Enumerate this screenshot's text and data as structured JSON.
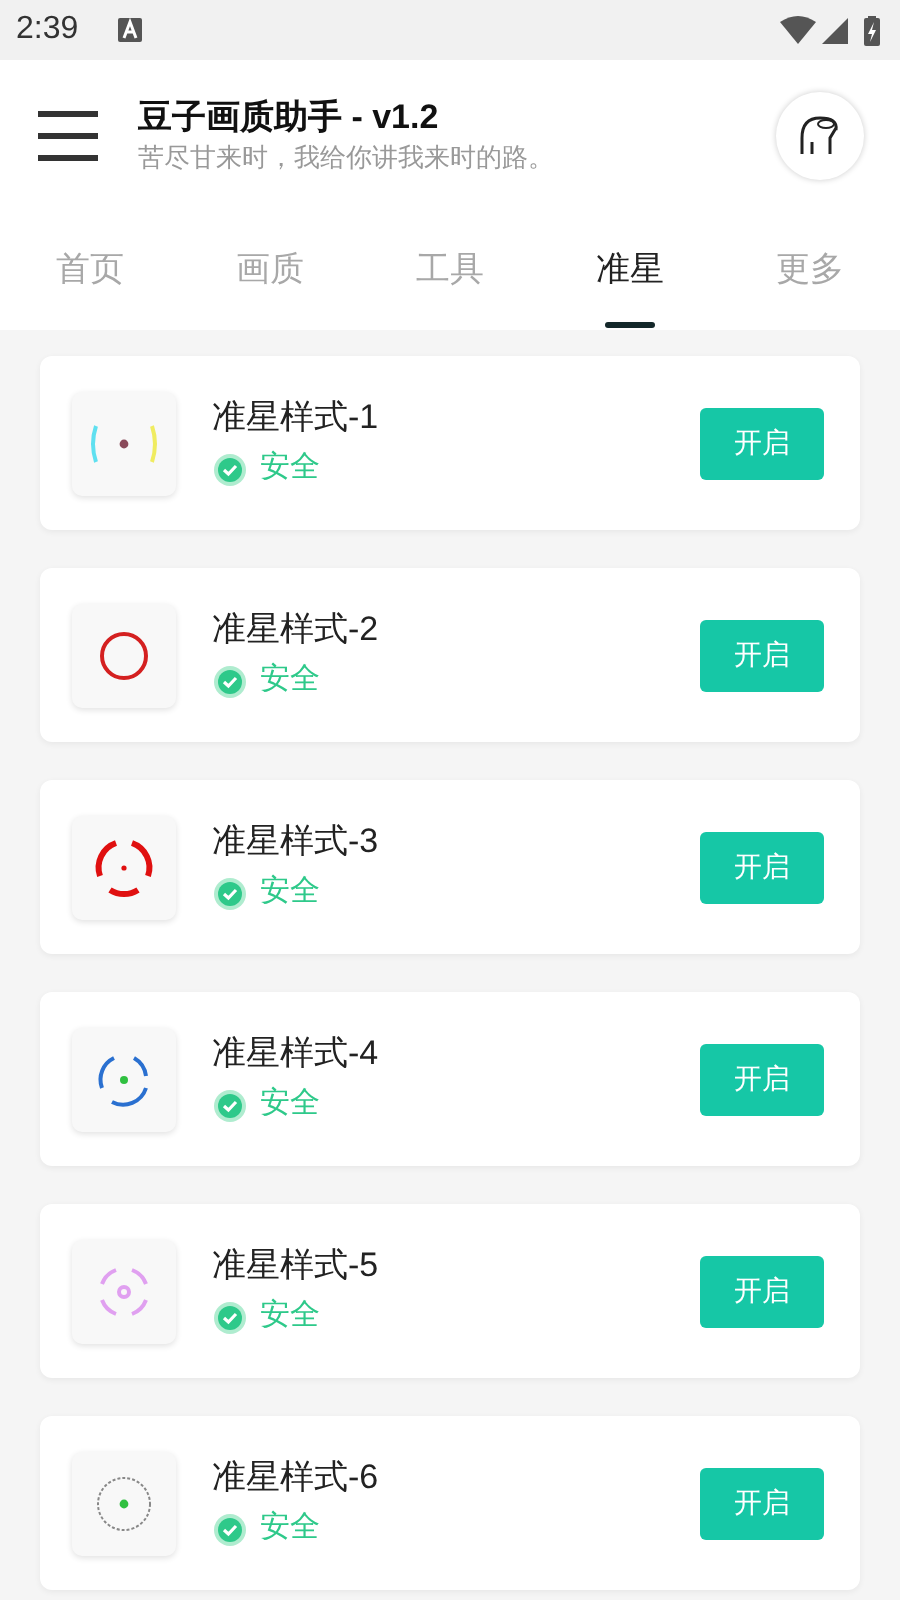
{
  "status_bar": {
    "time": "2:39"
  },
  "header": {
    "title": "豆子画质助手 - v1.2",
    "subtitle": "苦尽甘来时，我给你讲我来时的路。"
  },
  "tabs": [
    {
      "label": "首页",
      "selected": false
    },
    {
      "label": "画质",
      "selected": false
    },
    {
      "label": "工具",
      "selected": false
    },
    {
      "label": "准星",
      "selected": true
    },
    {
      "label": "更多",
      "selected": false
    }
  ],
  "items": [
    {
      "title": "准星样式-1",
      "badge": "安全",
      "button": "开启"
    },
    {
      "title": "准星样式-2",
      "badge": "安全",
      "button": "开启"
    },
    {
      "title": "准星样式-3",
      "badge": "安全",
      "button": "开启"
    },
    {
      "title": "准星样式-4",
      "badge": "安全",
      "button": "开启"
    },
    {
      "title": "准星样式-5",
      "badge": "安全",
      "button": "开启"
    },
    {
      "title": "准星样式-6",
      "badge": "安全",
      "button": "开启"
    }
  ]
}
